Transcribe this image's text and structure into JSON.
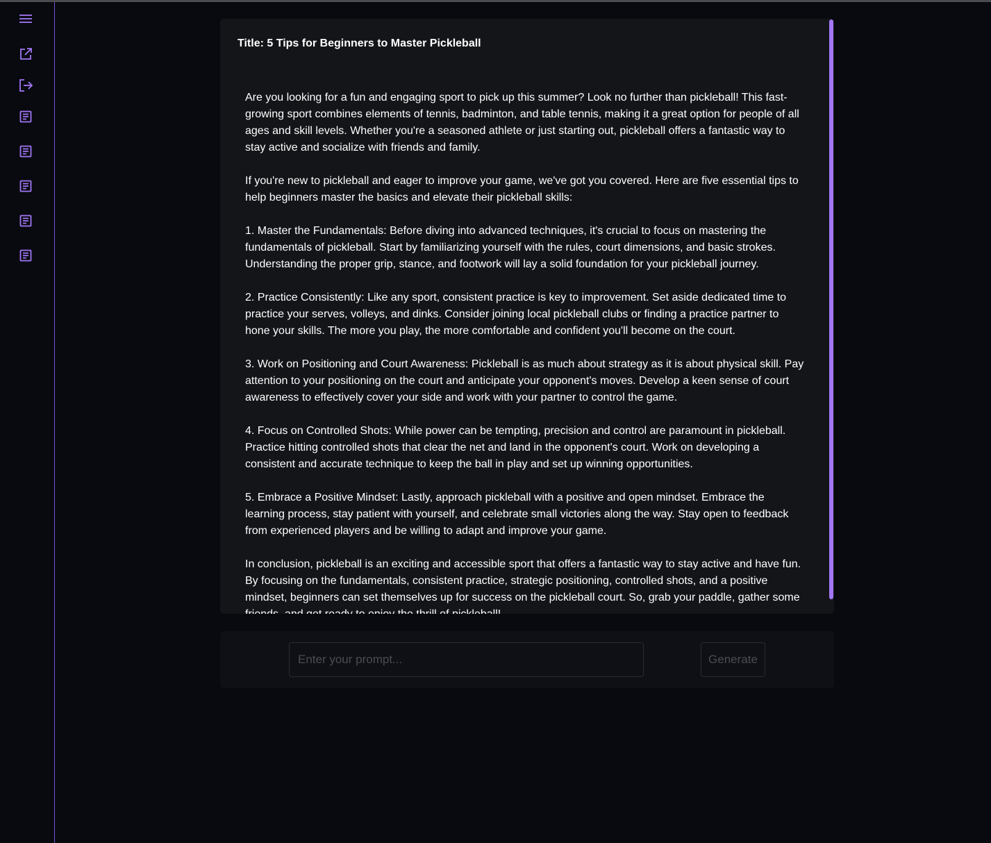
{
  "colors": {
    "accent": "#a277f5",
    "background": "#090a10",
    "card": "#141519"
  },
  "sidebar": {
    "items": [
      {
        "name": "menu-icon"
      },
      {
        "name": "new-window-icon"
      },
      {
        "name": "logout-icon"
      },
      {
        "name": "document-icon"
      },
      {
        "name": "document-icon"
      },
      {
        "name": "document-icon"
      },
      {
        "name": "document-icon"
      },
      {
        "name": "document-icon"
      }
    ]
  },
  "article": {
    "title": "Title: 5 Tips for Beginners to Master Pickleball",
    "paragraphs": [
      "Are you looking for a fun and engaging sport to pick up this summer? Look no further than pickleball! This fast-growing sport combines elements of tennis, badminton, and table tennis, making it a great option for people of all ages and skill levels. Whether you're a seasoned athlete or just starting out, pickleball offers a fantastic way to stay active and socialize with friends and family.",
      "If you're new to pickleball and eager to improve your game, we've got you covered. Here are five essential tips to help beginners master the basics and elevate their pickleball skills:",
      "1. Master the Fundamentals: Before diving into advanced techniques, it's crucial to focus on mastering the fundamentals of pickleball. Start by familiarizing yourself with the rules, court dimensions, and basic strokes. Understanding the proper grip, stance, and footwork will lay a solid foundation for your pickleball journey.",
      "2. Practice Consistently: Like any sport, consistent practice is key to improvement. Set aside dedicated time to practice your serves, volleys, and dinks. Consider joining local pickleball clubs or finding a practice partner to hone your skills. The more you play, the more comfortable and confident you'll become on the court.",
      "3. Work on Positioning and Court Awareness: Pickleball is as much about strategy as it is about physical skill. Pay attention to your positioning on the court and anticipate your opponent's moves. Develop a keen sense of court awareness to effectively cover your side and work with your partner to control the game.",
      "4. Focus on Controlled Shots: While power can be tempting, precision and control are paramount in pickleball. Practice hitting controlled shots that clear the net and land in the opponent's court. Work on developing a consistent and accurate technique to keep the ball in play and set up winning opportunities.",
      "5. Embrace a Positive Mindset: Lastly, approach pickleball with a positive and open mindset. Embrace the learning process, stay patient with yourself, and celebrate small victories along the way. Stay open to feedback from experienced players and be willing to adapt and improve your game.",
      "In conclusion, pickleball is an exciting and accessible sport that offers a fantastic way to stay active and have fun. By focusing on the fundamentals, consistent practice, strategic positioning, controlled shots, and a positive mindset, beginners can set themselves up for success on the pickleball court. So, grab your paddle, gather some friends, and get ready to enjoy the thrill of pickleball!"
    ]
  },
  "prompt": {
    "placeholder": "Enter your prompt...",
    "value": "",
    "generate_label": "Generate"
  }
}
